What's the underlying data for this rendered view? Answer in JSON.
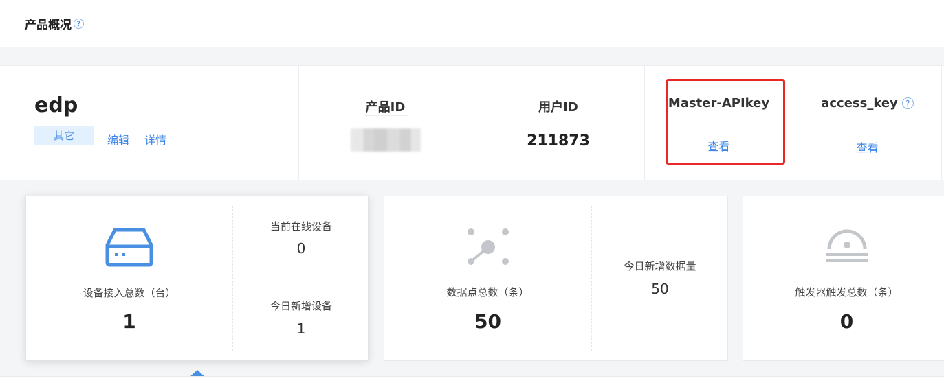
{
  "header": {
    "title": "产品概况",
    "help": "?"
  },
  "product": {
    "name": "edp",
    "category": "其它",
    "edit_link": "编辑",
    "details_link": "详情"
  },
  "info": {
    "product_id_label": "产品ID",
    "user_id_label": "用户ID",
    "user_id_value": "211873",
    "master_apikey_label": "Master-APIkey",
    "master_apikey_view": "查看",
    "access_key_label": "access_key",
    "access_key_help": "?",
    "access_key_view": "查看"
  },
  "cards": {
    "devices": {
      "label": "设备接入总数（台）",
      "value": "1",
      "online_label": "当前在线设备",
      "online_value": "0",
      "today_label": "今日新增设备",
      "today_value": "1"
    },
    "datapoints": {
      "label": "数据点总数（条）",
      "value": "50",
      "today_label": "今日新增数据量",
      "today_value": "50"
    },
    "triggers": {
      "label": "触发器触发总数（条）",
      "value": "0"
    }
  },
  "colors": {
    "accent": "#4a90e2",
    "highlight": "#e82727",
    "icon_gray": "#c3c6ca"
  },
  "icons": [
    "help-icon",
    "device-icon",
    "datapoint-icon",
    "trigger-icon"
  ]
}
